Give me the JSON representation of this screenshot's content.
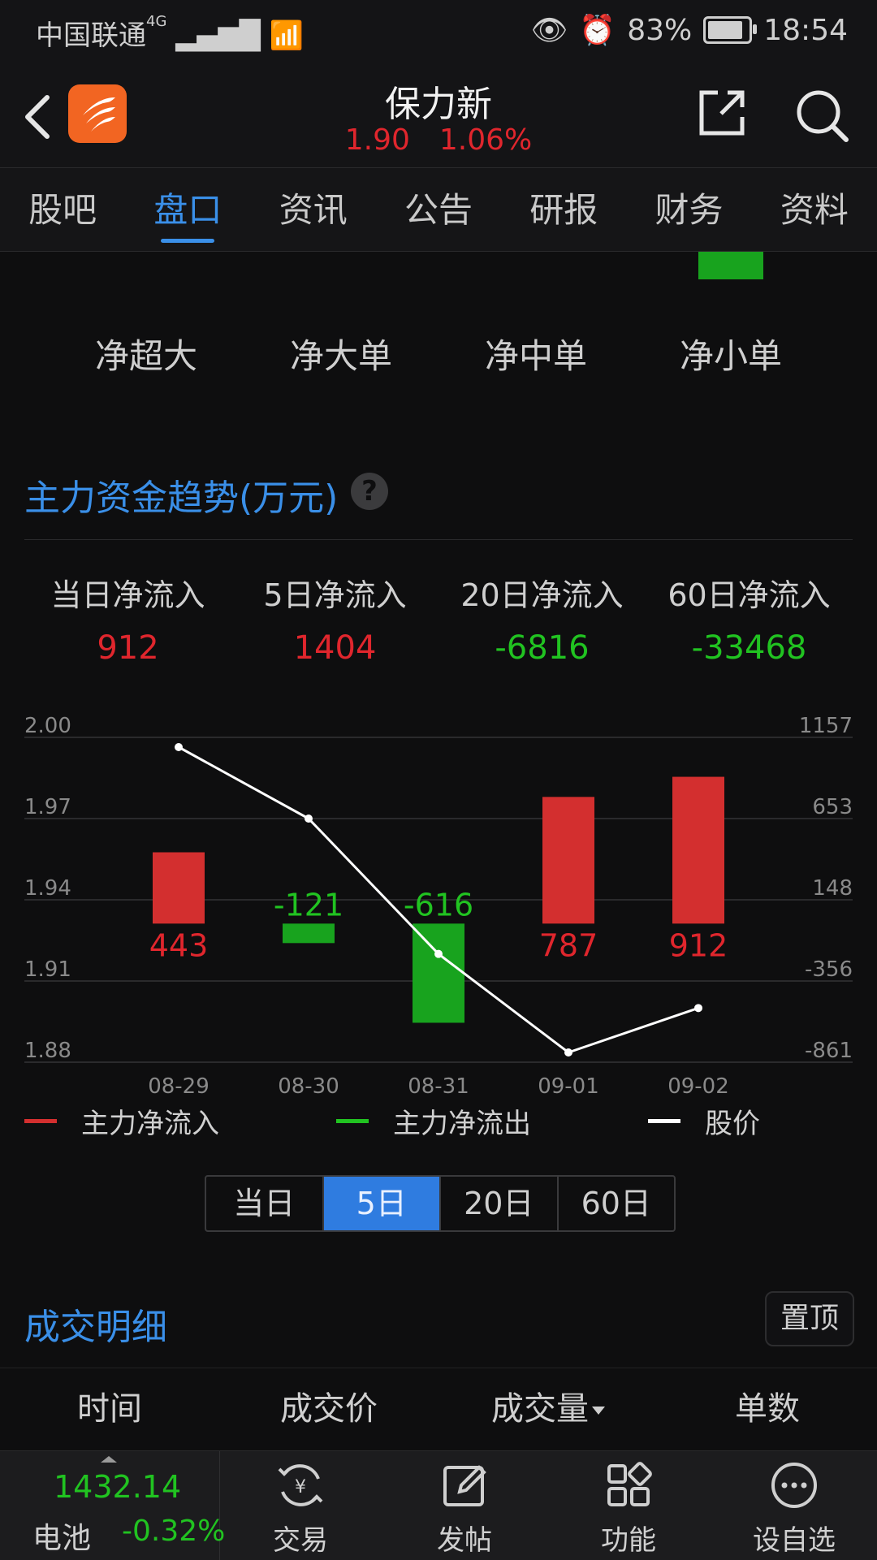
{
  "status_bar": {
    "carrier": "中国联通",
    "network": "4G",
    "battery": "83%",
    "time": "18:54"
  },
  "header": {
    "title": "保力新",
    "price": "1.90",
    "change_pct": "1.06%"
  },
  "tabs": [
    "股吧",
    "盘口",
    "资讯",
    "公告",
    "研报",
    "财务",
    "资料"
  ],
  "net_labels": [
    "净超大",
    "净大单",
    "净中单",
    "净小单"
  ],
  "trend": {
    "title": "主力资金趋势(万元)",
    "help": "?",
    "flows": [
      {
        "label": "当日净流入",
        "value": "912"
      },
      {
        "label": "5日净流入",
        "value": "1404"
      },
      {
        "label": "20日净流入",
        "value": "-6816"
      },
      {
        "label": "60日净流入",
        "value": "-33468"
      }
    ]
  },
  "chart_data": {
    "type": "bar",
    "categories": [
      "08-29",
      "08-30",
      "08-31",
      "09-01",
      "09-02"
    ],
    "series": [
      {
        "name": "主力净流入",
        "values": [
          443,
          null,
          null,
          787,
          912
        ],
        "color": "#d32f2f"
      },
      {
        "name": "主力净流出",
        "values": [
          null,
          -121,
          -616,
          null,
          null
        ],
        "color": "#18a31e"
      },
      {
        "name": "股价",
        "type": "line",
        "values": [
          2.0,
          1.97,
          1.92,
          1.88,
          1.9
        ],
        "color": "#ffffff"
      }
    ],
    "bar_labels": [
      "443",
      "-121",
      "-616",
      "787",
      "912"
    ],
    "y_left_ticks": [
      "2.00",
      "1.97",
      "1.94",
      "1.91",
      "1.88"
    ],
    "y_left_range": [
      1.88,
      2.0
    ],
    "y_right_ticks": [
      "1157",
      "653",
      "148",
      "-356",
      "-861"
    ],
    "y_right_range": [
      -861,
      1157
    ],
    "grid": true
  },
  "legend": [
    "主力净流入",
    "主力净流出",
    "股价"
  ],
  "periods": {
    "options": [
      "当日",
      "5日",
      "20日",
      "60日"
    ],
    "selected": "5日"
  },
  "deals": {
    "title": "成交明细",
    "pin_label": "置顶",
    "columns": [
      "时间",
      "成交价",
      "成交量",
      "单数"
    ]
  },
  "bottom_bar": {
    "index": {
      "value": "1432.14",
      "name": "电池",
      "change": "-0.32%"
    },
    "buttons": [
      "交易",
      "发帖",
      "功能",
      "设自选"
    ]
  }
}
